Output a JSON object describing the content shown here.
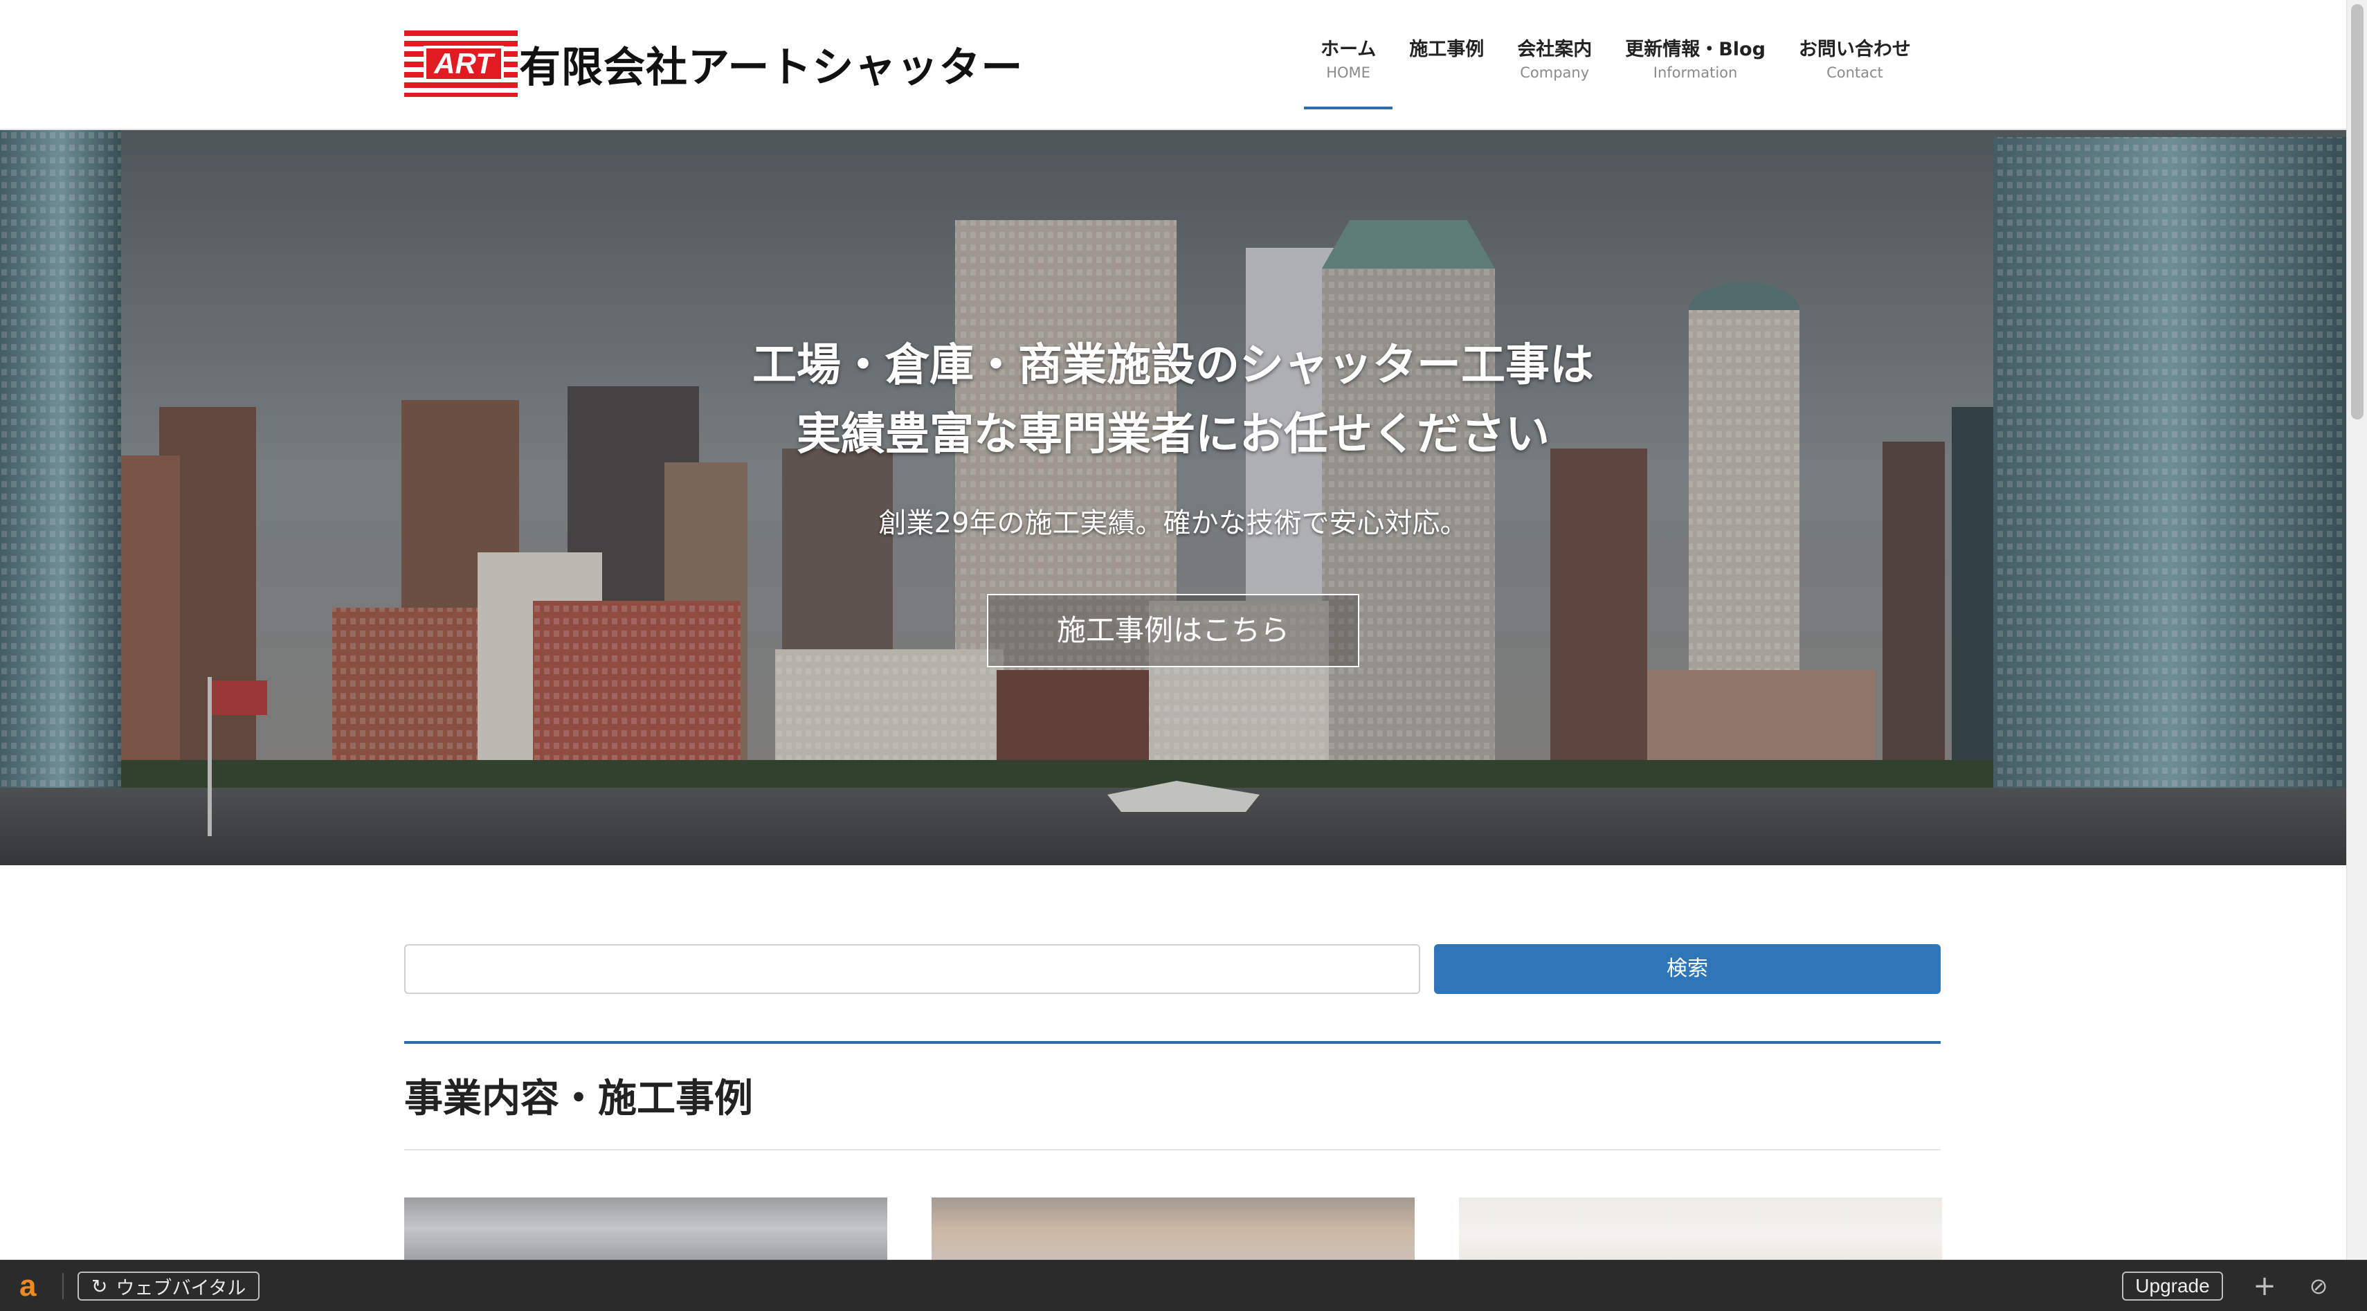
{
  "header": {
    "logo_mark": "ART",
    "company_name": "有限会社アートシャッター",
    "nav": [
      {
        "jp": "ホーム",
        "en": "HOME"
      },
      {
        "jp": "施工事例",
        "en": ""
      },
      {
        "jp": "会社案内",
        "en": "Company"
      },
      {
        "jp": "更新情報・Blog",
        "en": "Information"
      },
      {
        "jp": "お問い合わせ",
        "en": "Contact"
      }
    ],
    "accent_color": "#2d6ea8"
  },
  "hero": {
    "title_line1": "工場・倉庫・商業施設のシャッター工事は",
    "title_line2": "実績豊富な専門業者にお任せください",
    "subtitle": "創業29年の施工実績。確かな技術で安心対応。",
    "button_label": "施工事例はこちら"
  },
  "search": {
    "placeholder": "",
    "button_label": "検索",
    "button_color": "#2f76b9"
  },
  "section": {
    "title": "事業内容・施工事例"
  },
  "toolbar": {
    "logo_glyph": "a",
    "vitals_label": "ウェブバイタル",
    "upgrade_label": "Upgrade",
    "brand_color": "#f08a1c"
  }
}
